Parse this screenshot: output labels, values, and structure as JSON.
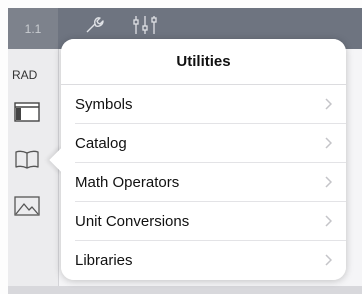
{
  "header": {
    "page_tab": "1.1",
    "tools_icon": "wrench-icon",
    "settings_icon": "sliders-icon"
  },
  "sidebar": {
    "angle_mode": "RAD",
    "icons": [
      "layout-icon",
      "book-icon",
      "image-icon"
    ]
  },
  "popover": {
    "title": "Utilities",
    "items": [
      {
        "label": "Symbols"
      },
      {
        "label": "Catalog"
      },
      {
        "label": "Math Operators"
      },
      {
        "label": "Unit Conversions"
      },
      {
        "label": "Libraries"
      }
    ]
  },
  "colors": {
    "topbar": "#6e7480",
    "sidebar": "#ececee",
    "popover_bg": "#ffffff",
    "chevron": "#c4c4c8"
  }
}
